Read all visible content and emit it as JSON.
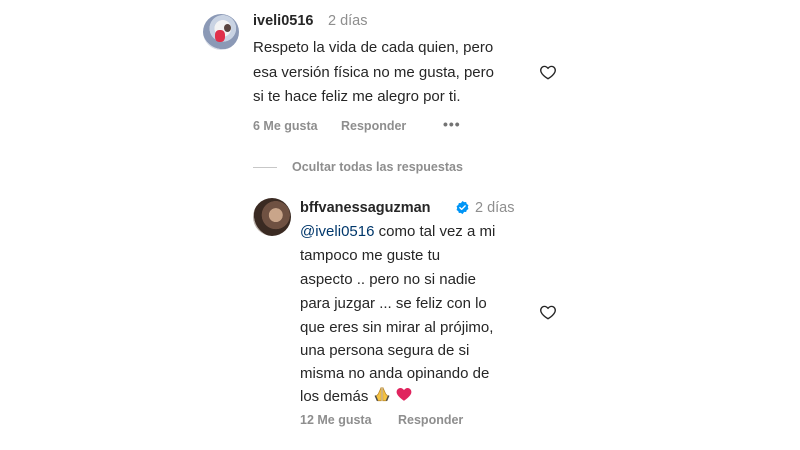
{
  "comment": {
    "username": "iveli0516",
    "time": "2 días",
    "lines": [
      "Respeto la vida de cada quien, pero",
      "esa versión física no me gusta, pero",
      "si te hace feliz me alegro por ti."
    ],
    "likes": "6 Me gusta",
    "reply_label": "Responder",
    "more_label": "•••"
  },
  "toggle_replies": "Ocultar todas las respuestas",
  "reply": {
    "username": "bffvanessaguzman",
    "time": "2 días",
    "mention": "@iveli0516",
    "first_line_rest": " como tal vez a mi",
    "lines": [
      "tampoco me guste tu",
      "aspecto .. pero no si nadie",
      "para juzgar ... se feliz con lo",
      "que eres sin mirar al prójimo,",
      "una persona segura de si",
      "misma no anda opinando de",
      "los demás"
    ],
    "emojis": [
      "praying-hands",
      "red-heart"
    ],
    "likes": "12 Me gusta",
    "reply_label": "Responder"
  },
  "colors": {
    "text": "#262626",
    "muted": "#8e8e8e",
    "mention": "#00376b",
    "verified": "#0095f6",
    "heart_emoji": "#e0245e"
  }
}
